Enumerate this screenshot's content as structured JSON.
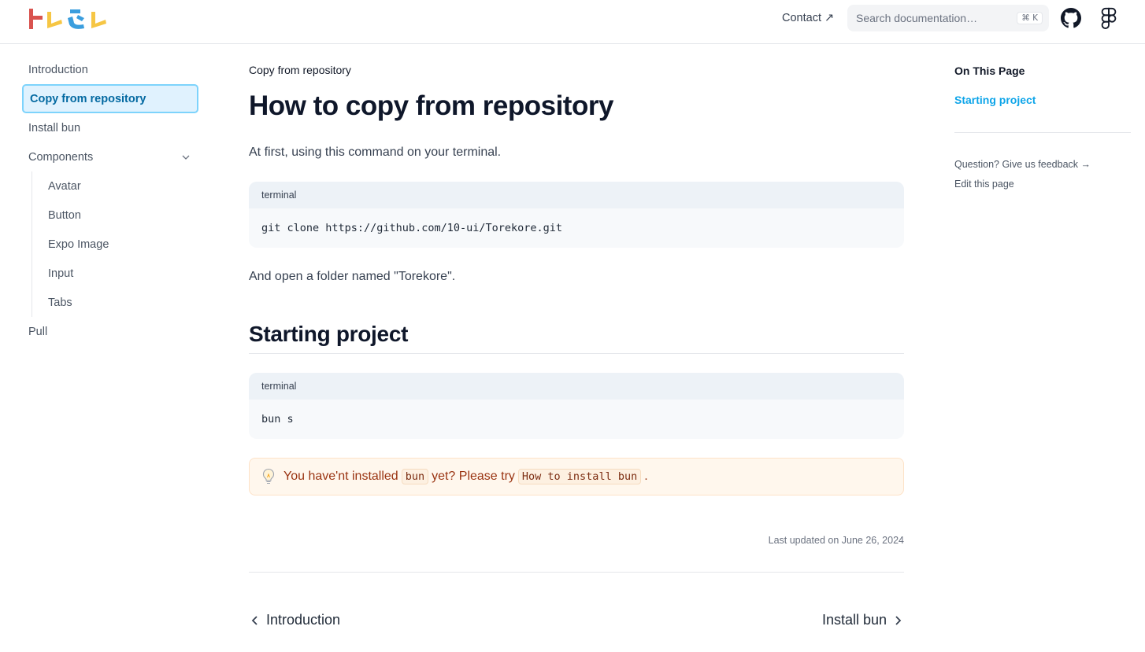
{
  "header": {
    "logo_alt": "Torekore",
    "contact_label": "Contact ↗",
    "search_placeholder": "Search documentation…",
    "search_shortcut": "⌘ K",
    "colors": {
      "logo_red": "#d9534f",
      "logo_yellow": "#f6c644",
      "logo_blue": "#3b9ede"
    }
  },
  "sidebar": {
    "items": [
      {
        "label": "Introduction"
      },
      {
        "label": "Copy from repository"
      },
      {
        "label": "Install bun"
      },
      {
        "label": "Components"
      },
      {
        "label": "Pull"
      }
    ],
    "components_children": [
      {
        "label": "Avatar"
      },
      {
        "label": "Button"
      },
      {
        "label": "Expo Image"
      },
      {
        "label": "Input"
      },
      {
        "label": "Tabs"
      }
    ]
  },
  "main": {
    "breadcrumb": "Copy from repository",
    "title": "How to copy from repository",
    "intro": "At first, using this command on your terminal.",
    "code1": {
      "label": "terminal",
      "code": "git clone https://github.com/10-ui/Torekore.git"
    },
    "after_code": "And open a folder named \"Torekore\".",
    "section_title": "Starting project",
    "code2": {
      "label": "terminal",
      "code": "bun s"
    },
    "callout": {
      "text_a": "You have'nt installed",
      "code_a": "bun",
      "text_b": "yet? Please try",
      "code_b": "How to install bun",
      "text_c": "."
    },
    "last_updated": "Last updated on June 26, 2024",
    "prev": "Introduction",
    "next": "Install bun"
  },
  "toc": {
    "title": "On This Page",
    "link": "Starting project",
    "feedback": "Question? Give us feedback →",
    "edit": "Edit this page"
  },
  "colors": {
    "accent": "#0ea5e9",
    "active_bg": "#e0f2fe",
    "callout_bg": "#fff7ed"
  }
}
